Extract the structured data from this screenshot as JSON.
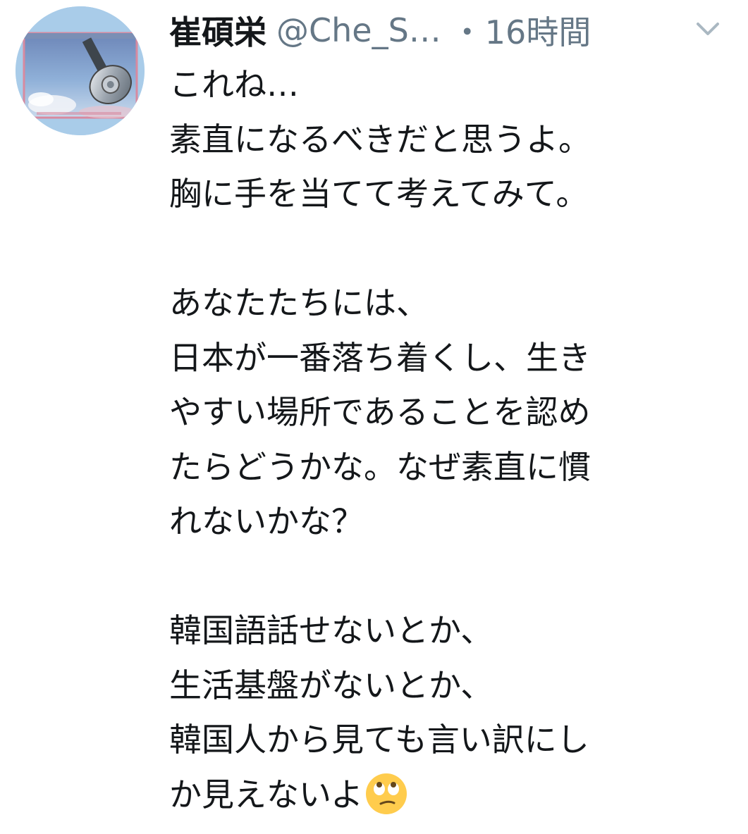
{
  "tweet": {
    "display_name": "崔碩栄",
    "handle": "@Che_S…",
    "separator": "・",
    "time": "16時間",
    "more_icon": "chevron-down-icon",
    "avatar_icon": "album-cover-avatar",
    "lines": [
      "これね…",
      "素直になるべきだと思うよ。",
      "胸に手を当てて考えてみて。",
      "",
      "あなたたちには、",
      "日本が一番落ち着くし、生き",
      "やすい場所であることを認め",
      "たらどうかな。なぜ素直に慣",
      "れないかな？",
      "",
      "韓国語話せないとか、",
      "生活基盤がないとか、",
      "韓国人から見ても言い訳にし",
      "か見えないよ"
    ],
    "trailing_emoji": "face-with-rolling-eyes-emoji"
  },
  "colors": {
    "text_primary": "#14171a",
    "text_secondary": "#657786",
    "chevron": "#aab8c2",
    "emoji_yellow": "#ffcc4d"
  }
}
